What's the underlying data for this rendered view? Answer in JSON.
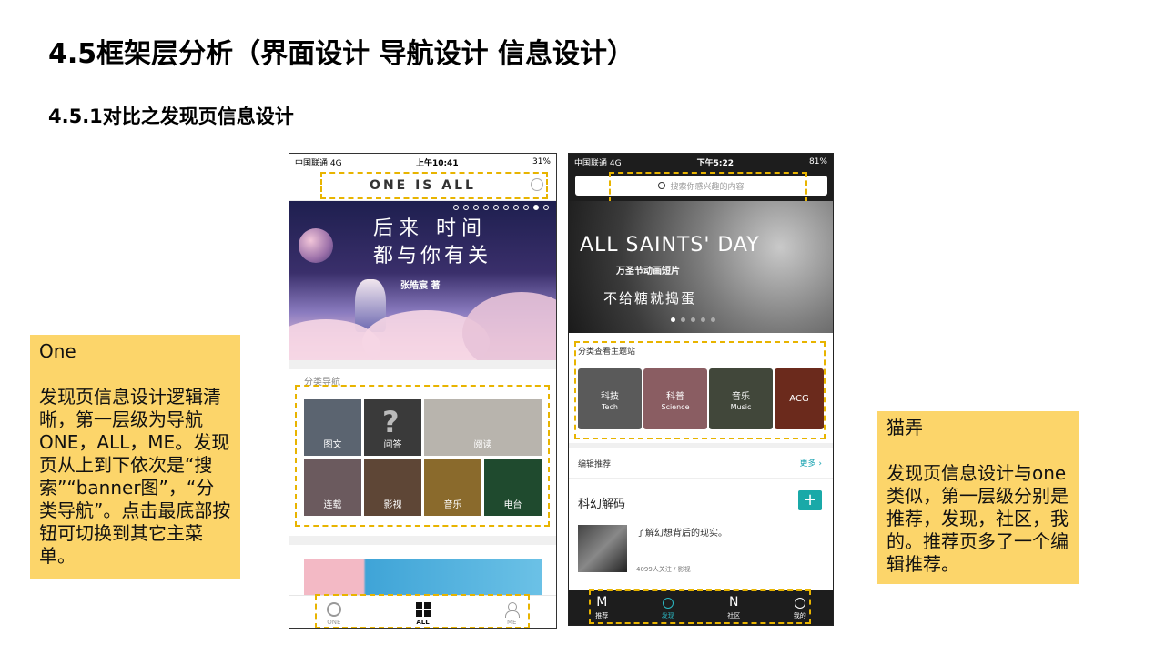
{
  "slide": {
    "title": "4.5框架层分析（界面设计 导航设计 信息设计）",
    "subtitle": "4.5.1对比之发现页信息设计"
  },
  "note_left": {
    "title": "One",
    "body": "发现页信息设计逻辑清晰，第一层级为导航ONE，ALL，ME。发现页从上到下依次是“搜索”“banner图”，“分类导航”。点击最底部按钮可切换到其它主菜单。"
  },
  "note_right": {
    "title": "猫弄",
    "body": "发现页信息设计与one类似，第一层级分别是推荐，发现，社区，我的。推荐页多了一个编辑推荐。"
  },
  "phone_one": {
    "status": {
      "carrier": "中国联通  4G",
      "time": "上午10:41",
      "battery": "31%"
    },
    "logo": "ONE  IS  ALL",
    "banner": {
      "line1": "后来 时间",
      "line2": "都与你有关",
      "author": "张皓宸 著"
    },
    "section_label": "分类导航",
    "categories": [
      {
        "label": "图文",
        "color": "#5b6470"
      },
      {
        "label": "问答",
        "color": "#3a3a3a"
      },
      {
        "label": "阅读",
        "color": "#b8b4ad"
      },
      {
        "label": "连载",
        "color": "#6b5a5e"
      },
      {
        "label": "影视",
        "color": "#5e4636"
      },
      {
        "label": "音乐",
        "color": "#8a6a2c"
      },
      {
        "label": "电台",
        "color": "#1f4a2e"
      }
    ],
    "tabs": [
      {
        "label": "ONE",
        "icon": "one-circle-icon"
      },
      {
        "label": "ALL",
        "icon": "grid-icon"
      },
      {
        "label": "ME",
        "icon": "user-icon"
      }
    ]
  },
  "phone_two": {
    "status": {
      "carrier": "中国联通  4G",
      "time": "下午5:22",
      "battery": "81%"
    },
    "search_placeholder": "搜索你感兴趣的内容",
    "banner": {
      "headline": "ALL SAINTS' DAY",
      "caption": "万圣节动画短片",
      "tagline": "不给糖就捣蛋"
    },
    "section_label": "分类查看主题站",
    "categories": [
      {
        "label": "科技",
        "sub": "Tech",
        "color": "#5a5a5a"
      },
      {
        "label": "科普",
        "sub": "Science",
        "color": "#8a5d62"
      },
      {
        "label": "音乐",
        "sub": "Music",
        "color": "#41473a"
      },
      {
        "label": "ACG",
        "sub": "",
        "color": "#6b2a1c"
      }
    ],
    "editor_label": "编辑推荐",
    "more_label": "更多",
    "card": {
      "title": "科幻解码",
      "plus": "+",
      "desc": "了解幻想背后的现实。",
      "meta": "4099人关注 / 影视"
    },
    "tabs": [
      {
        "glyph": "M",
        "label": "推荐"
      },
      {
        "glyph": "",
        "label": "发现"
      },
      {
        "glyph": "N",
        "label": "社区"
      },
      {
        "glyph": "",
        "label": "我的"
      }
    ]
  },
  "colors": {
    "note_bg": "#fcd56a",
    "dash": "#e8b400",
    "teal": "#19a9a8"
  }
}
